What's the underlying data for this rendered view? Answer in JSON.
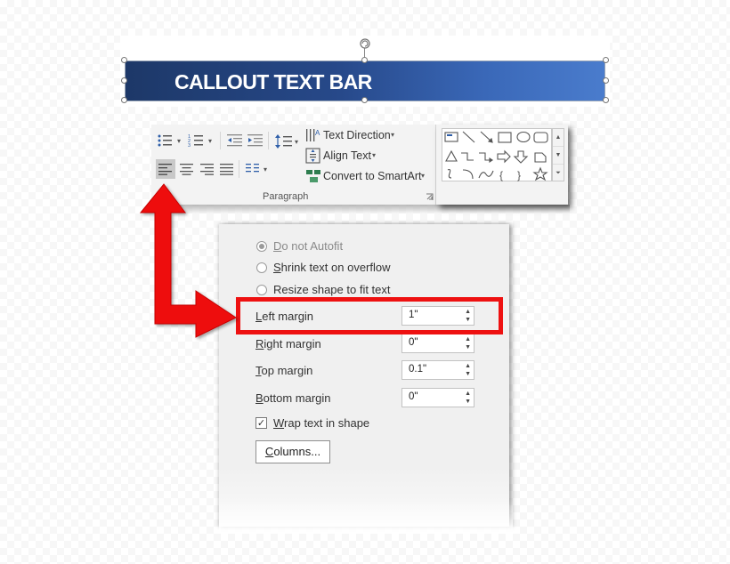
{
  "banner": {
    "text": "CALLOUT TEXT BAR"
  },
  "ribbon": {
    "text_direction_label": "Text Direction",
    "align_text_label": "Align Text",
    "convert_smartart_label": "Convert to SmartArt",
    "paragraph_group_label": "Paragraph",
    "dropdown_glyph": "▾",
    "selected_alignment": "align-left"
  },
  "dialog": {
    "autofit": [
      {
        "label_u": "D",
        "label_rest": "o not Autofit",
        "selected": true
      },
      {
        "label_u": "S",
        "label_rest": "hrink text on overflow",
        "selected": false
      },
      {
        "label_u": "",
        "label_rest": "Resize shape to fit text",
        "selected": false
      }
    ],
    "margins": [
      {
        "label_u": "L",
        "label_rest": "eft margin",
        "value": "1\""
      },
      {
        "label_u": "R",
        "label_rest": "ight margin",
        "value": "0\""
      },
      {
        "label_u": "T",
        "label_rest": "op margin",
        "value": "0.1\""
      },
      {
        "label_u": "B",
        "label_rest": "ottom margin",
        "value": "0\""
      }
    ],
    "wrap": {
      "label_u": "W",
      "label_rest": "rap text in shape",
      "checked": true
    },
    "columns_button": {
      "label_u": "C",
      "label_rest": "olumns..."
    }
  },
  "colors": {
    "highlight": "#ee1111",
    "arrow": "#ee1111",
    "banner_start": "#1d3868",
    "banner_end": "#4a7ccd"
  }
}
